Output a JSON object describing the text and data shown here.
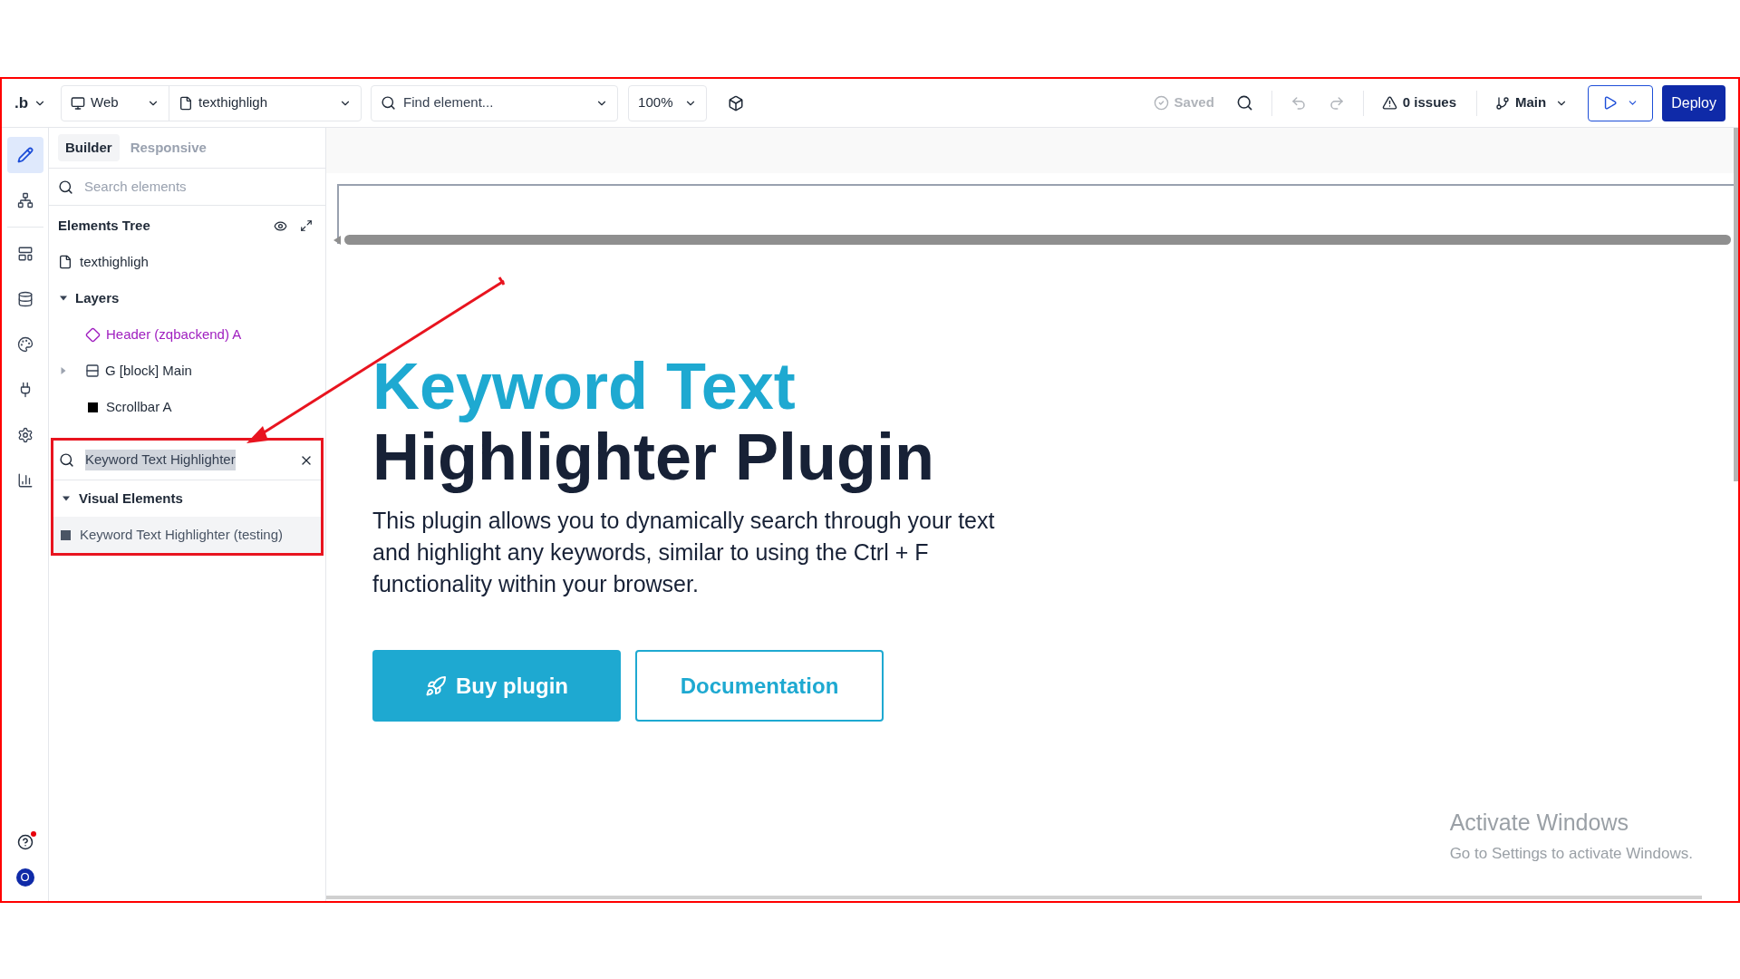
{
  "toolbar": {
    "logo": ".b",
    "device": "Web",
    "page": "texthighligh",
    "find_placeholder": "Find element...",
    "zoom": "100%",
    "saved": "Saved",
    "issues": "0 issues",
    "branch": "Main",
    "deploy": "Deploy"
  },
  "rail": {
    "top_items": [
      {
        "kind": "design",
        "selected": true
      },
      {
        "kind": "tree",
        "selected": false
      }
    ],
    "items": [
      {
        "kind": "layout",
        "selected": false
      },
      {
        "kind": "data",
        "selected": false
      },
      {
        "kind": "styles",
        "selected": false
      },
      {
        "kind": "plugins",
        "selected": false
      },
      {
        "kind": "settings",
        "selected": false
      },
      {
        "kind": "logs",
        "selected": false
      }
    ],
    "help_notification": true,
    "avatar": "O"
  },
  "sidebar": {
    "tabs": [
      {
        "label": "Builder",
        "selected": true
      },
      {
        "label": "Responsive",
        "selected": false
      }
    ],
    "search_placeholder": "Search elements",
    "tree_title": "Elements Tree",
    "page": "texthighligh",
    "layers": {
      "label": "Layers",
      "expanded": true,
      "children": [
        {
          "label": "Header (zqbackend) A",
          "kind": "reusable"
        },
        {
          "label": "G [block] Main",
          "kind": "group",
          "expanded": false
        },
        {
          "label": "Scrollbar A",
          "kind": "element"
        }
      ]
    },
    "result_search": {
      "value": "Keyword Text Highlighter"
    },
    "results": [
      {
        "label": "Visual Elements",
        "expanded": true,
        "children": [
          {
            "label": "Keyword Text Highlighter (testing)",
            "hovered": true
          }
        ]
      }
    ]
  },
  "canvas": {
    "title_accent": "Keyword Text",
    "title": "Highlighter Plugin",
    "description": "This plugin allows you to dynamically search through your text and highlight any keywords, similar to using the Ctrl + F functionality within your browser.",
    "buttons": [
      {
        "label": "Buy plugin",
        "kind": "primary"
      },
      {
        "label": "Documentation",
        "kind": "outline"
      }
    ]
  },
  "os_notice": {
    "title": "Activate Windows",
    "text": "Go to Settings to activate Windows."
  }
}
